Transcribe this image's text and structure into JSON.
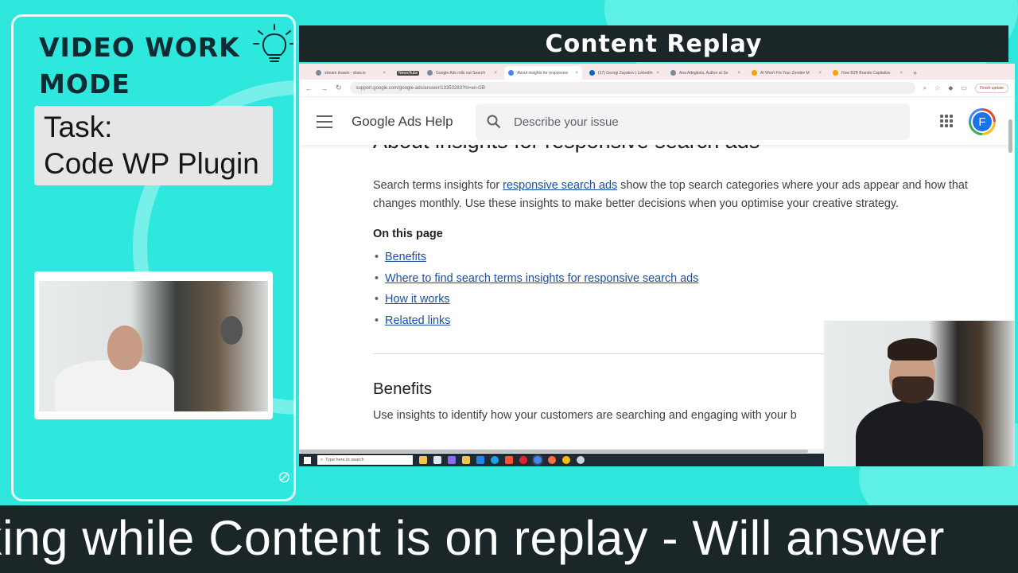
{
  "overlay": {
    "mode_title": "VIDEO WORK MODE",
    "task_label": "Task:",
    "task_value": "Code WP Plugin",
    "header_title": "Content Replay",
    "ticker_text": "king while Content is on replay - Will answer"
  },
  "browser": {
    "tabs": [
      {
        "title": "stream drawio - draw.io",
        "active": false
      },
      {
        "title": "NewsHubs",
        "active": false,
        "badge": true
      },
      {
        "title": "Google Ads rolls out Search",
        "active": false
      },
      {
        "title": "About insights for responsive",
        "active": true
      },
      {
        "title": "(17) Georgi Zayakov | LinkedIn",
        "active": false
      },
      {
        "title": "Ana Adegbola, Author at Se",
        "active": false
      },
      {
        "title": "AI Won't Fix Your Zombie M",
        "active": false
      },
      {
        "title": "How B2B Brands Capitalize",
        "active": false
      }
    ],
    "url": "support.google.com/google-ads/answer/13353283?hl=en-GB",
    "update_button": "Finish update"
  },
  "help_page": {
    "brand": "Google Ads Help",
    "search_placeholder": "Describe your issue",
    "avatar_letter": "F",
    "title": "About insights for responsive search ads",
    "intro_before": "Search terms insights for ",
    "intro_link": "responsive search ads",
    "intro_after": " show the top search categories where your ads appear and how that changes monthly. Use these insights to make better decisions when you optimise your creative strategy.",
    "toc_title": "On this page",
    "toc": [
      "Benefits",
      "Where to find search terms insights for responsive search ads",
      "How it works",
      "Related links"
    ],
    "section_title": "Benefits",
    "section_body": "Use insights to identify how your customers are searching and engaging with your b"
  },
  "taskbar": {
    "search_placeholder": "Type here to search"
  },
  "colors": {
    "background": "#2ee6dc",
    "dark_bar": "#1b2628",
    "link": "#1a4fa8",
    "avatar": "#1a73e8"
  }
}
